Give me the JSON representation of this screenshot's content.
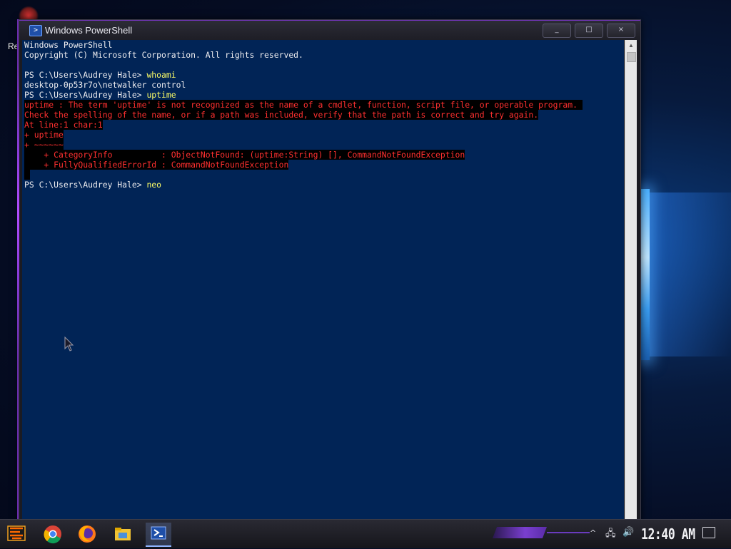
{
  "desktop": {
    "icon_label": "Re"
  },
  "window": {
    "title": "Windows PowerShell",
    "controls": {
      "minimize": "_",
      "maximize": "□",
      "close": "×"
    }
  },
  "console": {
    "lines": [
      {
        "text": "Windows PowerShell"
      },
      {
        "text": "Copyright (C) Microsoft Corporation. All rights reserved."
      },
      {
        "text": ""
      },
      {
        "prompt": "PS C:\\Users\\Audrey Hale> ",
        "command": "whoami"
      },
      {
        "text": "desktop-0p53r7o\\netwalker control"
      },
      {
        "prompt": "PS C:\\Users\\Audrey Hale> ",
        "command": "uptime"
      },
      {
        "error": "uptime : The term 'uptime' is not recognized as the name of a cmdlet, function, script file, or operable program. "
      },
      {
        "error": "Check the spelling of the name, or if a path was included, verify that the path is correct and try again."
      },
      {
        "error": "At line:1 char:1"
      },
      {
        "error": "+ uptime"
      },
      {
        "error": "+ ~~~~~~"
      },
      {
        "error": "    + CategoryInfo          : ObjectNotFound: (uptime:String) [], CommandNotFoundException"
      },
      {
        "error": "    + FullyQualifiedErrorId : CommandNotFoundException"
      },
      {
        "error_blank": true
      },
      {
        "prompt": "PS C:\\Users\\Audrey Hale> ",
        "command": "neo"
      }
    ],
    "colors": {
      "background": "#012456",
      "text": "#eeedf0",
      "command": "#ffff66",
      "error": "#ff3030"
    }
  },
  "taskbar": {
    "items": [
      "start-icon",
      "chrome-icon",
      "firefox-icon",
      "file-explorer-icon",
      "powershell-icon"
    ],
    "tray": {
      "chevron": "^",
      "network": "🖧",
      "volume": "🔊"
    },
    "clock": "12:40 AM"
  }
}
